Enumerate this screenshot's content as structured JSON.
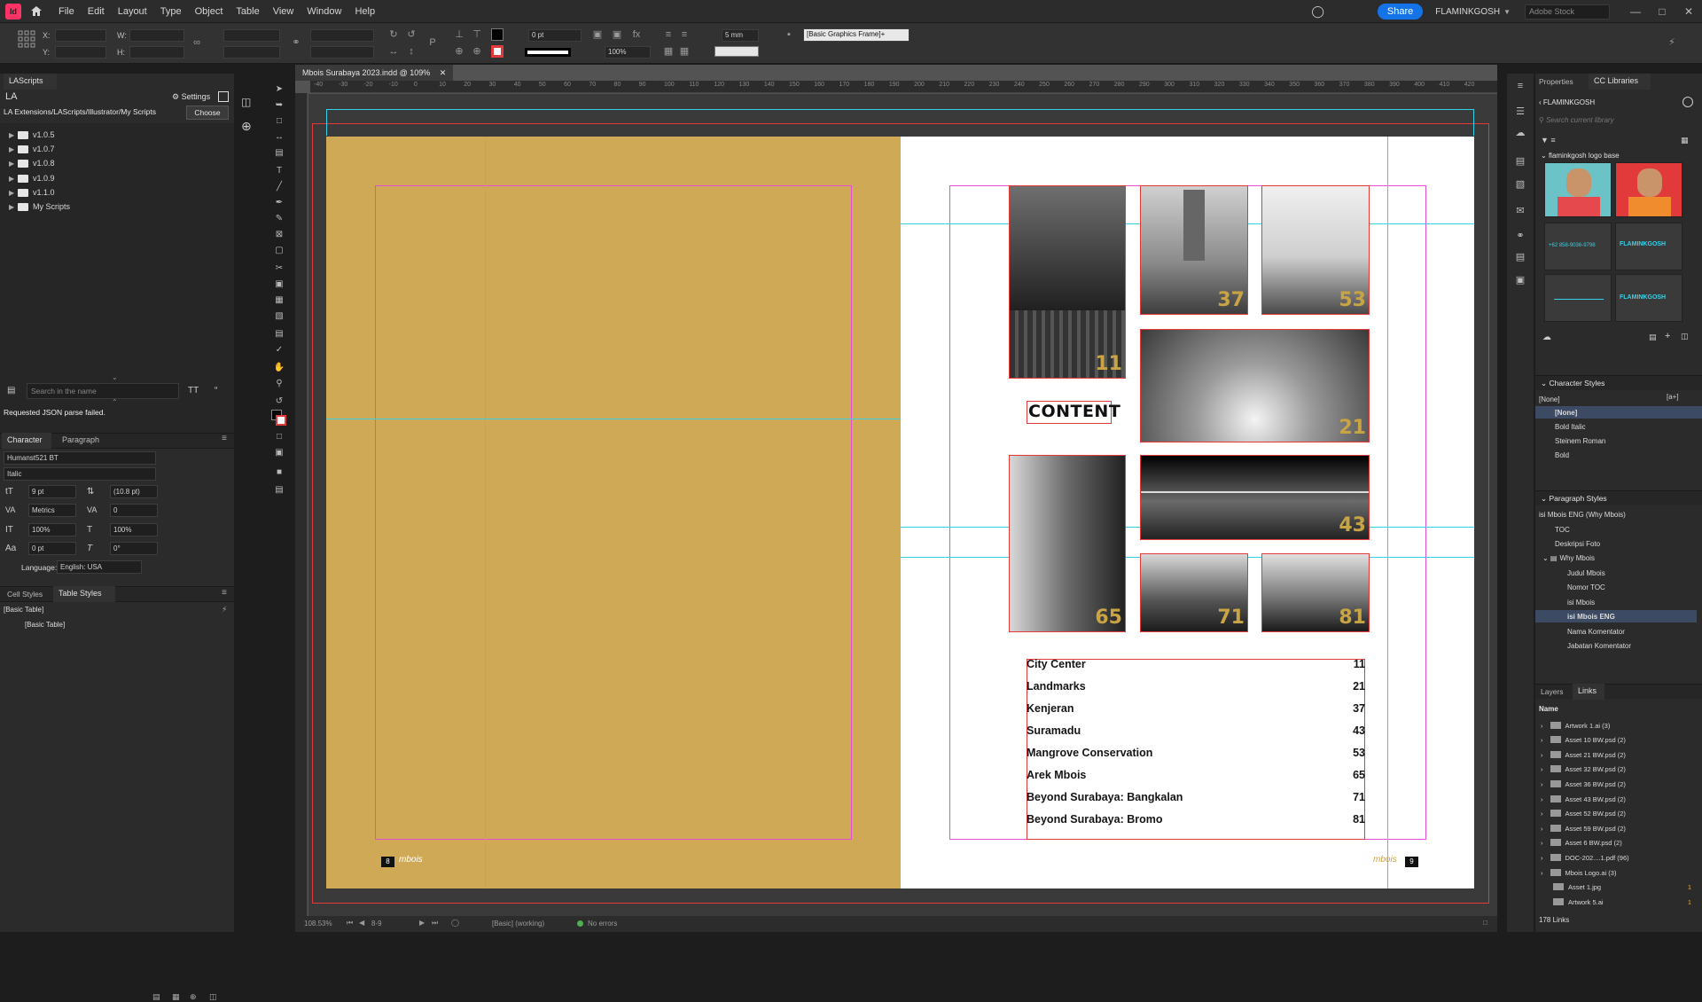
{
  "menubar": {
    "items": [
      "File",
      "Edit",
      "Layout",
      "Type",
      "Object",
      "Table",
      "View",
      "Window",
      "Help"
    ],
    "share_label": "Share",
    "user": "FLAMINKGOSH",
    "stock_placeholder": "Adobe Stock"
  },
  "controlbar": {
    "x_label": "X:",
    "y_label": "Y:",
    "w_label": "W:",
    "h_label": "H:",
    "stroke_weight": "0 pt",
    "scale_percent": "100%",
    "corner_size": "5 mm",
    "object_style": "[Basic Graphics Frame]+"
  },
  "document": {
    "tab_title": "Mbois Surabaya 2023.indd @ 109%",
    "ruler_marks": [
      "-40",
      "-30",
      "-20",
      "-10",
      "0",
      "10",
      "20",
      "30",
      "40",
      "50",
      "60",
      "70",
      "80",
      "90",
      "100",
      "110",
      "120",
      "130",
      "140",
      "150",
      "160",
      "170",
      "180",
      "190",
      "200",
      "210",
      "220",
      "230",
      "240",
      "250",
      "260",
      "270",
      "280",
      "290",
      "300",
      "310",
      "320",
      "330",
      "340",
      "350",
      "360",
      "370",
      "380",
      "390",
      "400",
      "410",
      "420"
    ],
    "content_heading": "CONTENT",
    "left_page_number": "8",
    "right_page_number": "9",
    "photo_numbers": [
      "11",
      "37",
      "53",
      "21",
      "65",
      "43",
      "71",
      "81"
    ],
    "toc": [
      {
        "title": "City Center",
        "page": "11"
      },
      {
        "title": "Landmarks",
        "page": "21"
      },
      {
        "title": "Kenjeran",
        "page": "37"
      },
      {
        "title": "Suramadu",
        "page": "43"
      },
      {
        "title": "Mangrove Conservation",
        "page": "53"
      },
      {
        "title": "Arek Mbois",
        "page": "65"
      },
      {
        "title": "Beyond Surabaya: Bangkalan",
        "page": "71"
      },
      {
        "title": "Beyond Surabaya: Bromo",
        "page": "81"
      }
    ],
    "footer_logo_text": "mbois"
  },
  "statusbar": {
    "zoom": "108.53%",
    "page": "8-9",
    "preflight_profile": "[Basic] (working)",
    "errors": "No errors"
  },
  "lascripts": {
    "tab_label": "LAScripts",
    "settings_label": "Settings",
    "path": "LA Extensions/LAScripts/Illustrator/My Scripts",
    "choose_label": "Choose",
    "folders": [
      "v1.0.5",
      "v1.0.7",
      "v1.0.8",
      "v1.0.9",
      "v1.1.0",
      "My Scripts"
    ],
    "search_placeholder": "Search in the name",
    "error_message": "Requested JSON parse failed."
  },
  "character": {
    "tab_character": "Character",
    "tab_paragraph": "Paragraph",
    "font": "Humanst521 BT",
    "style": "Italic",
    "size": "9 pt",
    "leading": "(10.8 pt)",
    "kerning": "Metrics",
    "tracking": "0",
    "vscale": "100%",
    "hscale": "100%",
    "baseline": "0 pt",
    "skew": "0°",
    "language_label": "Language:",
    "language": "English: USA"
  },
  "styles_panel": {
    "tab_cell": "Cell Styles",
    "tab_table": "Table Styles",
    "current": "[Basic Table]",
    "item": "[Basic Table]"
  },
  "rightpanel": {
    "tab_properties": "Properties",
    "tab_cc": "CC Libraries",
    "library_name": "FLAMINKGOSH",
    "search_placeholder": "Search current library",
    "group_name": "flaminkgosh logo base",
    "thumb_texts": [
      "+62 858-9036-9798",
      "FLAMINKGOSH",
      "FLAMINKGOSH"
    ],
    "char_styles_title": "Character Styles",
    "char_current": "[None]",
    "char_styles": [
      "[None]",
      "Bold Italic",
      "Steinem Roman",
      "Bold"
    ],
    "para_styles_title": "Paragraph Styles",
    "para_current": "isi Mbois ENG (Why Mbois)",
    "para_styles": [
      "TOC",
      "Deskripsi Foto",
      "Why Mbois",
      "Judul Mbois",
      "Nomor TOC",
      "isi Mbois",
      "isi Mbois ENG",
      "Nama Komentator",
      "Jabatan Komentator"
    ],
    "tab_layers": "Layers",
    "tab_links": "Links",
    "links_col_name": "Name",
    "links": [
      {
        "name": "Artwork 1.ai (3)",
        "badge": ""
      },
      {
        "name": "Asset 10 BW.psd (2)",
        "badge": ""
      },
      {
        "name": "Asset 21 BW.psd (2)",
        "badge": ""
      },
      {
        "name": "Asset 32 BW.psd (2)",
        "badge": ""
      },
      {
        "name": "Asset 36 BW.psd (2)",
        "badge": ""
      },
      {
        "name": "Asset 43 BW.psd (2)",
        "badge": ""
      },
      {
        "name": "Asset 52 BW.psd (2)",
        "badge": ""
      },
      {
        "name": "Asset 59 BW.psd (2)",
        "badge": ""
      },
      {
        "name": "Asset 6 BW.psd (2)",
        "badge": ""
      },
      {
        "name": "DOC-202....1.pdf (96)",
        "badge": ""
      },
      {
        "name": "Mbois Logo.ai (3)",
        "badge": ""
      },
      {
        "name": "Asset 1.jpg",
        "badge": "1"
      },
      {
        "name": "Artwork 5.ai",
        "badge": "1"
      }
    ],
    "links_count": "178 Links"
  },
  "colors": {
    "accent_blue": "#1473e6",
    "page_gold": "#cfa955",
    "frame_red": "#e23a3a",
    "guide_cyan": "#36d1e8",
    "margin_magenta": "#e04fd4",
    "photo_number_gold": "#c9a445"
  }
}
